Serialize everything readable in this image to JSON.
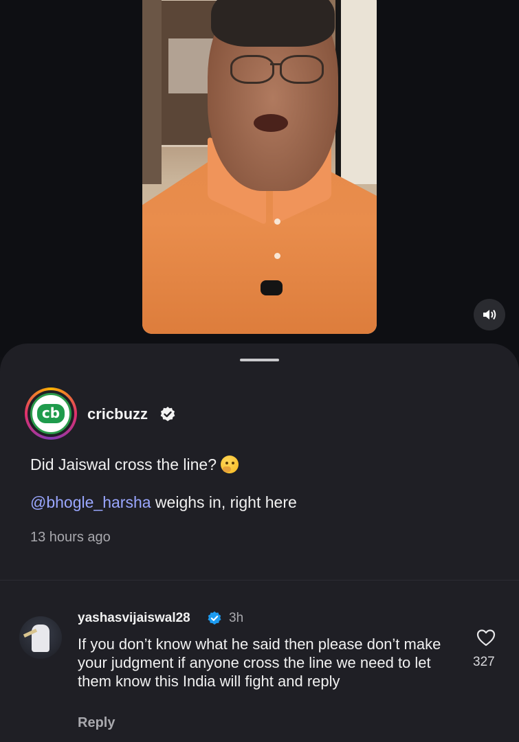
{
  "post": {
    "username": "cricbuzz",
    "avatar_text": "cb",
    "caption_line1": "Did Jaiswal cross the line?",
    "caption_mention": "@bhogle_harsha",
    "caption_line2_rest": " weighs in, right here",
    "time_ago": "13 hours ago"
  },
  "comment": {
    "username": "yashasvijaiswal28",
    "time": "3h",
    "text": "If you don’t know what he said then please don’t make your judgment if  anyone cross the line we need to let them know this India will fight and reply",
    "reply_label": "Reply",
    "likes": "327"
  },
  "icons": {
    "sound": "speaker-icon",
    "verified": "verified-badge-icon",
    "like": "heart-icon",
    "emoji": "thinking-face-emoji"
  },
  "colors": {
    "sheet_bg": "#1f1f25",
    "mention": "#9aa7ff",
    "verified_blue": "#1d9bf0",
    "brand_green": "#1f9b4c"
  }
}
